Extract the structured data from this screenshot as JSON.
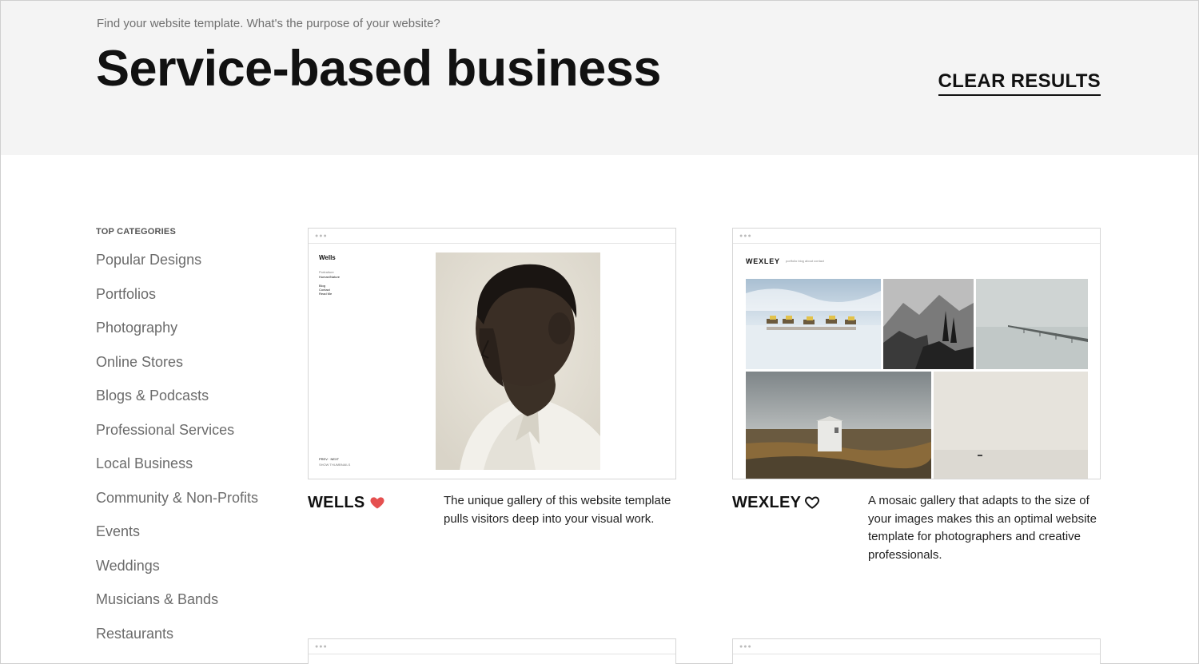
{
  "header": {
    "prompt": "Find your website template. What's the purpose of your website?",
    "title": "Service-based business",
    "clear_label": "CLEAR RESULTS"
  },
  "sidebar": {
    "heading": "TOP CATEGORIES",
    "items": [
      {
        "label": "Popular Designs"
      },
      {
        "label": "Portfolios"
      },
      {
        "label": "Photography"
      },
      {
        "label": "Online Stores"
      },
      {
        "label": "Blogs & Podcasts"
      },
      {
        "label": "Professional Services"
      },
      {
        "label": "Local Business"
      },
      {
        "label": "Community & Non-Profits"
      },
      {
        "label": "Events"
      },
      {
        "label": "Weddings"
      },
      {
        "label": "Musicians & Bands"
      },
      {
        "label": "Restaurants"
      }
    ]
  },
  "templates": [
    {
      "name": "WELLS",
      "favorited": true,
      "heart_icon": "heart-filled-icon",
      "description": "The unique gallery of this website template pulls visitors deep into your visual work.",
      "preview": {
        "brand": "Wells",
        "nav": [
          "Portraiture",
          "Human/Nature"
        ],
        "links": [
          "Blog",
          "Contact",
          "Read Me"
        ],
        "footer": [
          "PREV · NEXT",
          "SHOW THUMBNAILS"
        ]
      }
    },
    {
      "name": "WEXLEY",
      "favorited": false,
      "heart_icon": "heart-outline-icon",
      "description": "A mosaic gallery that adapts to the size of your images makes this an optimal website template for photographers and creative professionals.",
      "preview": {
        "brand": "WEXLEY",
        "links": "portfolio    blog    about    contact"
      }
    }
  ],
  "colors": {
    "hero_bg": "#f4f4f4",
    "heart_filled": "#e5504f",
    "category_text": "#6b6b6b"
  }
}
